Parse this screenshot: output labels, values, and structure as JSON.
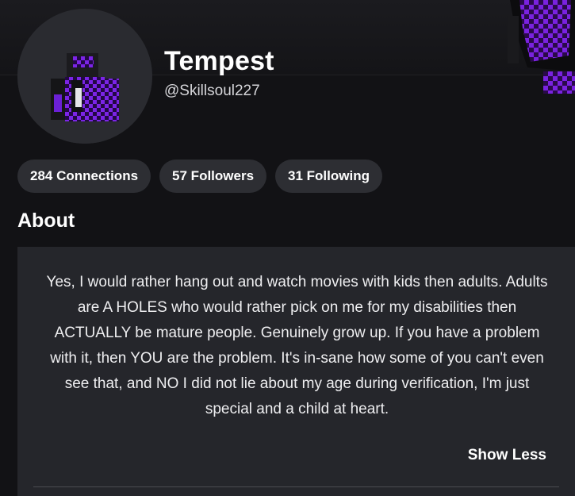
{
  "profile": {
    "display_name": "Tempest",
    "username": "@Skillsoul227",
    "avatar_icon": "avatar-image",
    "banner_icon": "banner-avatar-image"
  },
  "stats": {
    "connections": "284 Connections",
    "followers": "57 Followers",
    "following": "31 Following"
  },
  "about": {
    "title": "About",
    "text": "Yes, I would rather hang out and watch movies with kids then adults. Adults are A HOLES who would rather pick on me for my disabilities then ACTUALLY be mature people. Genuinely grow up. If you have a problem with it, then YOU are the problem. It's in-sane how some of you can't even see that, and NO I did not lie about my age during verification, I'm just special and a child at heart.",
    "toggle_label": "Show Less"
  },
  "colors": {
    "background": "#121215",
    "card": "#25262b",
    "chip": "#2d2e33",
    "accent_purple": "#6a18c8"
  }
}
